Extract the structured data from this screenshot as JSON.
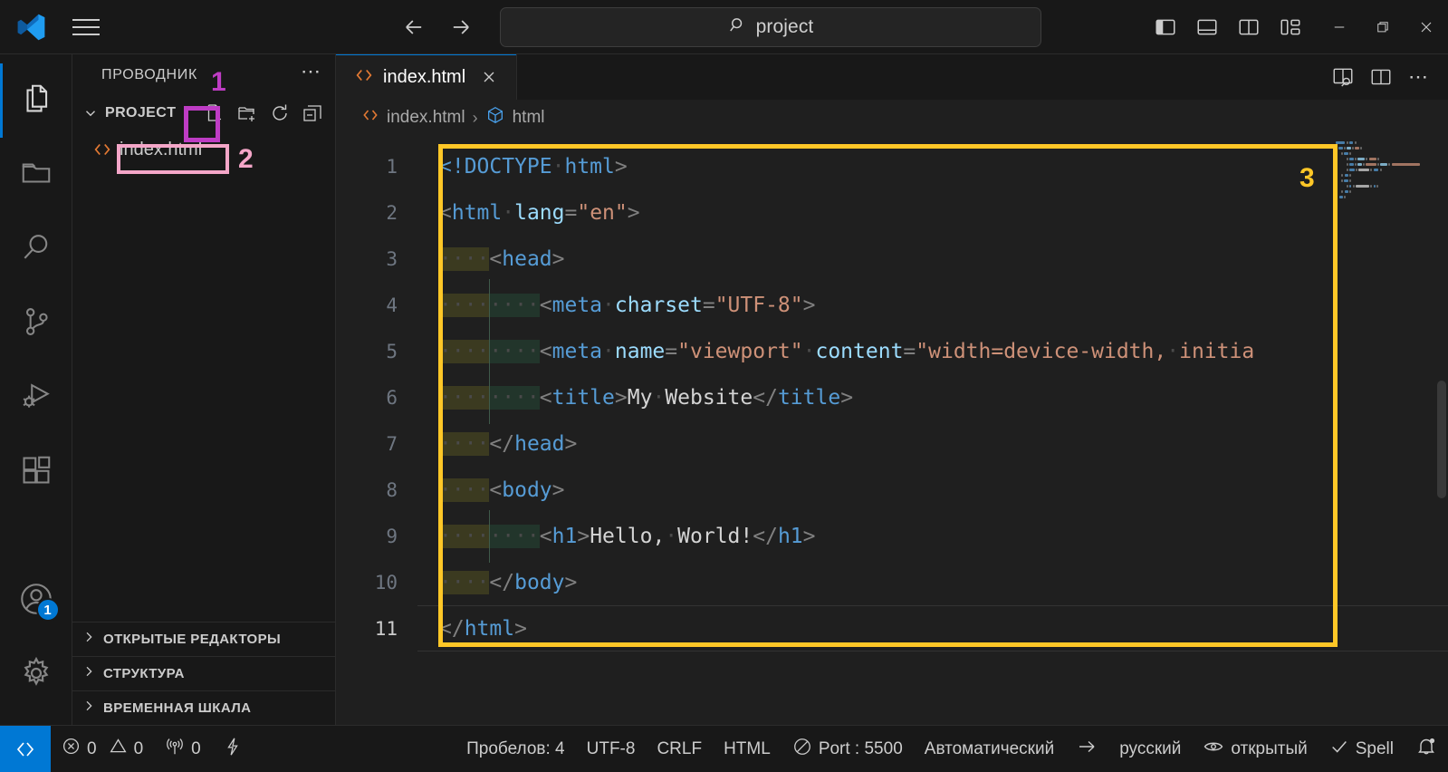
{
  "titlebar": {
    "logo_icon": "vscode-logo-icon",
    "menu_icon": "hamburger-menu-icon",
    "back_icon": "arrow-left-icon",
    "forward_icon": "arrow-right-icon",
    "command_center": {
      "search_icon": "search-icon",
      "value": "project"
    },
    "layout_buttons": [
      {
        "name": "toggle-primary-sidebar",
        "icon": "layout-sidebar-left-icon"
      },
      {
        "name": "toggle-panel",
        "icon": "layout-panel-icon"
      },
      {
        "name": "toggle-secondary-sidebar",
        "icon": "layout-sidebar-right-icon"
      },
      {
        "name": "customize-layout",
        "icon": "layout-customize-icon"
      }
    ],
    "window_buttons": [
      {
        "name": "minimize-button",
        "glyph": "–"
      },
      {
        "name": "maximize-button",
        "glyph": "❐"
      },
      {
        "name": "close-button",
        "glyph": "✕"
      }
    ]
  },
  "activitybar": {
    "items": [
      {
        "name": "explorer",
        "icon": "files-icon",
        "active": true
      },
      {
        "name": "open-folder",
        "icon": "folder-icon",
        "active": false
      },
      {
        "name": "search",
        "icon": "search-icon",
        "active": false
      },
      {
        "name": "source-control",
        "icon": "source-control-icon",
        "active": false
      },
      {
        "name": "run-and-debug",
        "icon": "run-debug-icon",
        "active": false
      },
      {
        "name": "extensions",
        "icon": "extensions-icon",
        "active": false
      }
    ],
    "account": {
      "icon": "account-icon",
      "badge": "1"
    },
    "settings": {
      "icon": "gear-icon"
    }
  },
  "sidebar": {
    "title": "ПРОВОДНИК",
    "more_actions_icon": "ellipsis-icon",
    "project": {
      "label": "PROJECT",
      "chevron_icon": "chevron-down-icon",
      "actions": [
        {
          "name": "new-file-button",
          "icon": "new-file-icon"
        },
        {
          "name": "new-folder-button",
          "icon": "new-folder-icon"
        },
        {
          "name": "refresh-explorer-button",
          "icon": "refresh-icon"
        },
        {
          "name": "collapse-folders-button",
          "icon": "collapse-all-icon"
        }
      ]
    },
    "files": [
      {
        "name": "index.html",
        "icon": "html-file-icon"
      }
    ],
    "collapsed_sections": [
      {
        "label": "ОТКРЫТЫЕ РЕДАКТОРЫ",
        "chevron_icon": "chevron-right-icon"
      },
      {
        "label": "СТРУКТУРА",
        "chevron_icon": "chevron-right-icon"
      },
      {
        "label": "ВРЕМЕННАЯ ШКАЛА",
        "chevron_icon": "chevron-right-icon"
      }
    ]
  },
  "editor": {
    "tab": {
      "label": "index.html",
      "icon": "html-file-icon",
      "close_icon": "close-icon"
    },
    "toolbar": [
      {
        "name": "open-preview-button",
        "icon": "open-preview-icon"
      },
      {
        "name": "split-editor-button",
        "icon": "split-editor-icon"
      },
      {
        "name": "more-editor-actions-button",
        "icon": "ellipsis-icon"
      }
    ],
    "breadcrumb": {
      "file": "index.html",
      "file_icon": "html-file-icon",
      "separator": "›",
      "symbol": "html",
      "symbol_icon": "symbol-cube-icon"
    },
    "line_numbers": [
      "1",
      "2",
      "3",
      "4",
      "5",
      "6",
      "7",
      "8",
      "9",
      "10",
      "11"
    ],
    "active_line": 11,
    "code_lines": [
      {
        "n": 1,
        "indent": 0,
        "tokens": [
          {
            "t": "<!DOCTYPE",
            "c": "doctype"
          },
          {
            "t": "·",
            "c": "ws"
          },
          {
            "t": "html",
            "c": "tag"
          },
          {
            "t": ">",
            "c": "br"
          }
        ]
      },
      {
        "n": 2,
        "indent": 0,
        "tokens": [
          {
            "t": "<",
            "c": "br"
          },
          {
            "t": "html",
            "c": "tag"
          },
          {
            "t": "·",
            "c": "ws"
          },
          {
            "t": "lang",
            "c": "attr"
          },
          {
            "t": "=",
            "c": "br"
          },
          {
            "t": "\"en\"",
            "c": "str"
          },
          {
            "t": ">",
            "c": "br"
          }
        ]
      },
      {
        "n": 3,
        "indent": 1,
        "tokens": [
          {
            "t": "<",
            "c": "br"
          },
          {
            "t": "head",
            "c": "tag"
          },
          {
            "t": ">",
            "c": "br"
          }
        ]
      },
      {
        "n": 4,
        "indent": 2,
        "tokens": [
          {
            "t": "<",
            "c": "br"
          },
          {
            "t": "meta",
            "c": "tag"
          },
          {
            "t": "·",
            "c": "ws"
          },
          {
            "t": "charset",
            "c": "attr"
          },
          {
            "t": "=",
            "c": "br"
          },
          {
            "t": "\"UTF-8\"",
            "c": "str"
          },
          {
            "t": ">",
            "c": "br"
          }
        ]
      },
      {
        "n": 5,
        "indent": 2,
        "tokens": [
          {
            "t": "<",
            "c": "br"
          },
          {
            "t": "meta",
            "c": "tag"
          },
          {
            "t": "·",
            "c": "ws"
          },
          {
            "t": "name",
            "c": "attr"
          },
          {
            "t": "=",
            "c": "br"
          },
          {
            "t": "\"viewport\"",
            "c": "str"
          },
          {
            "t": "·",
            "c": "ws"
          },
          {
            "t": "content",
            "c": "attr"
          },
          {
            "t": "=",
            "c": "br"
          },
          {
            "t": "\"width=device-width,·initia",
            "c": "str"
          }
        ]
      },
      {
        "n": 6,
        "indent": 2,
        "tokens": [
          {
            "t": "<",
            "c": "br"
          },
          {
            "t": "title",
            "c": "tag"
          },
          {
            "t": ">",
            "c": "br"
          },
          {
            "t": "My·Website",
            "c": "txt"
          },
          {
            "t": "</",
            "c": "br"
          },
          {
            "t": "title",
            "c": "tag"
          },
          {
            "t": ">",
            "c": "br"
          }
        ]
      },
      {
        "n": 7,
        "indent": 1,
        "tokens": [
          {
            "t": "</",
            "c": "br"
          },
          {
            "t": "head",
            "c": "tag"
          },
          {
            "t": ">",
            "c": "br"
          }
        ]
      },
      {
        "n": 8,
        "indent": 1,
        "tokens": [
          {
            "t": "<",
            "c": "br"
          },
          {
            "t": "body",
            "c": "tag"
          },
          {
            "t": ">",
            "c": "br"
          }
        ]
      },
      {
        "n": 9,
        "indent": 2,
        "tokens": [
          {
            "t": "<",
            "c": "br"
          },
          {
            "t": "h1",
            "c": "tag"
          },
          {
            "t": ">",
            "c": "br"
          },
          {
            "t": "Hello,·World!",
            "c": "txt"
          },
          {
            "t": "</",
            "c": "br"
          },
          {
            "t": "h1",
            "c": "tag"
          },
          {
            "t": ">",
            "c": "br"
          }
        ]
      },
      {
        "n": 10,
        "indent": 1,
        "tokens": [
          {
            "t": "</",
            "c": "br"
          },
          {
            "t": "body",
            "c": "tag"
          },
          {
            "t": ">",
            "c": "br"
          }
        ]
      },
      {
        "n": 11,
        "indent": 0,
        "tokens": [
          {
            "t": "</",
            "c": "br"
          },
          {
            "t": "html",
            "c": "tag"
          },
          {
            "t": ">",
            "c": "br"
          }
        ]
      }
    ]
  },
  "statusbar": {
    "remote_icon": "remote-window-icon",
    "items": [
      {
        "name": "problems",
        "icon": "error-icon",
        "text": "0",
        "icon2": "warning-icon",
        "text2": "0"
      },
      {
        "name": "ports",
        "icon": "radio-tower-icon",
        "text": "0"
      },
      {
        "name": "live-share",
        "icon": "zap-icon",
        "text": ""
      },
      {
        "name": "indentation",
        "icon": "",
        "text": "Пробелов: 4"
      },
      {
        "name": "encoding",
        "icon": "",
        "text": "UTF-8"
      },
      {
        "name": "eol",
        "icon": "",
        "text": "CRLF"
      },
      {
        "name": "language-mode",
        "icon": "",
        "text": "HTML"
      },
      {
        "name": "live-server-port",
        "icon": "circle-slash-icon",
        "text": "Port : 5500"
      },
      {
        "name": "translate-source",
        "icon": "",
        "text": "Автоматический"
      },
      {
        "name": "translate-arrow",
        "icon": "arrow-right-icon",
        "text": ""
      },
      {
        "name": "translate-target",
        "icon": "",
        "text": "русский"
      },
      {
        "name": "open-status",
        "icon": "eye-icon",
        "text": "открытый"
      },
      {
        "name": "spell-checker",
        "icon": "check-icon",
        "text": "Spell"
      },
      {
        "name": "notifications",
        "icon": "bell-dot-icon",
        "text": ""
      }
    ]
  },
  "annotations": {
    "colors": {
      "magenta": "#BE3CC4",
      "pink": "#F4A6C8",
      "yellow": "#FFC727"
    },
    "markers": [
      {
        "id": "1",
        "color": "#BE3CC4",
        "target": "explorer-title"
      },
      {
        "id": "2",
        "color": "#F4A6C8",
        "target": "index-html-file"
      },
      {
        "id": "3",
        "color": "#FFC727",
        "target": "code-editor"
      }
    ]
  }
}
